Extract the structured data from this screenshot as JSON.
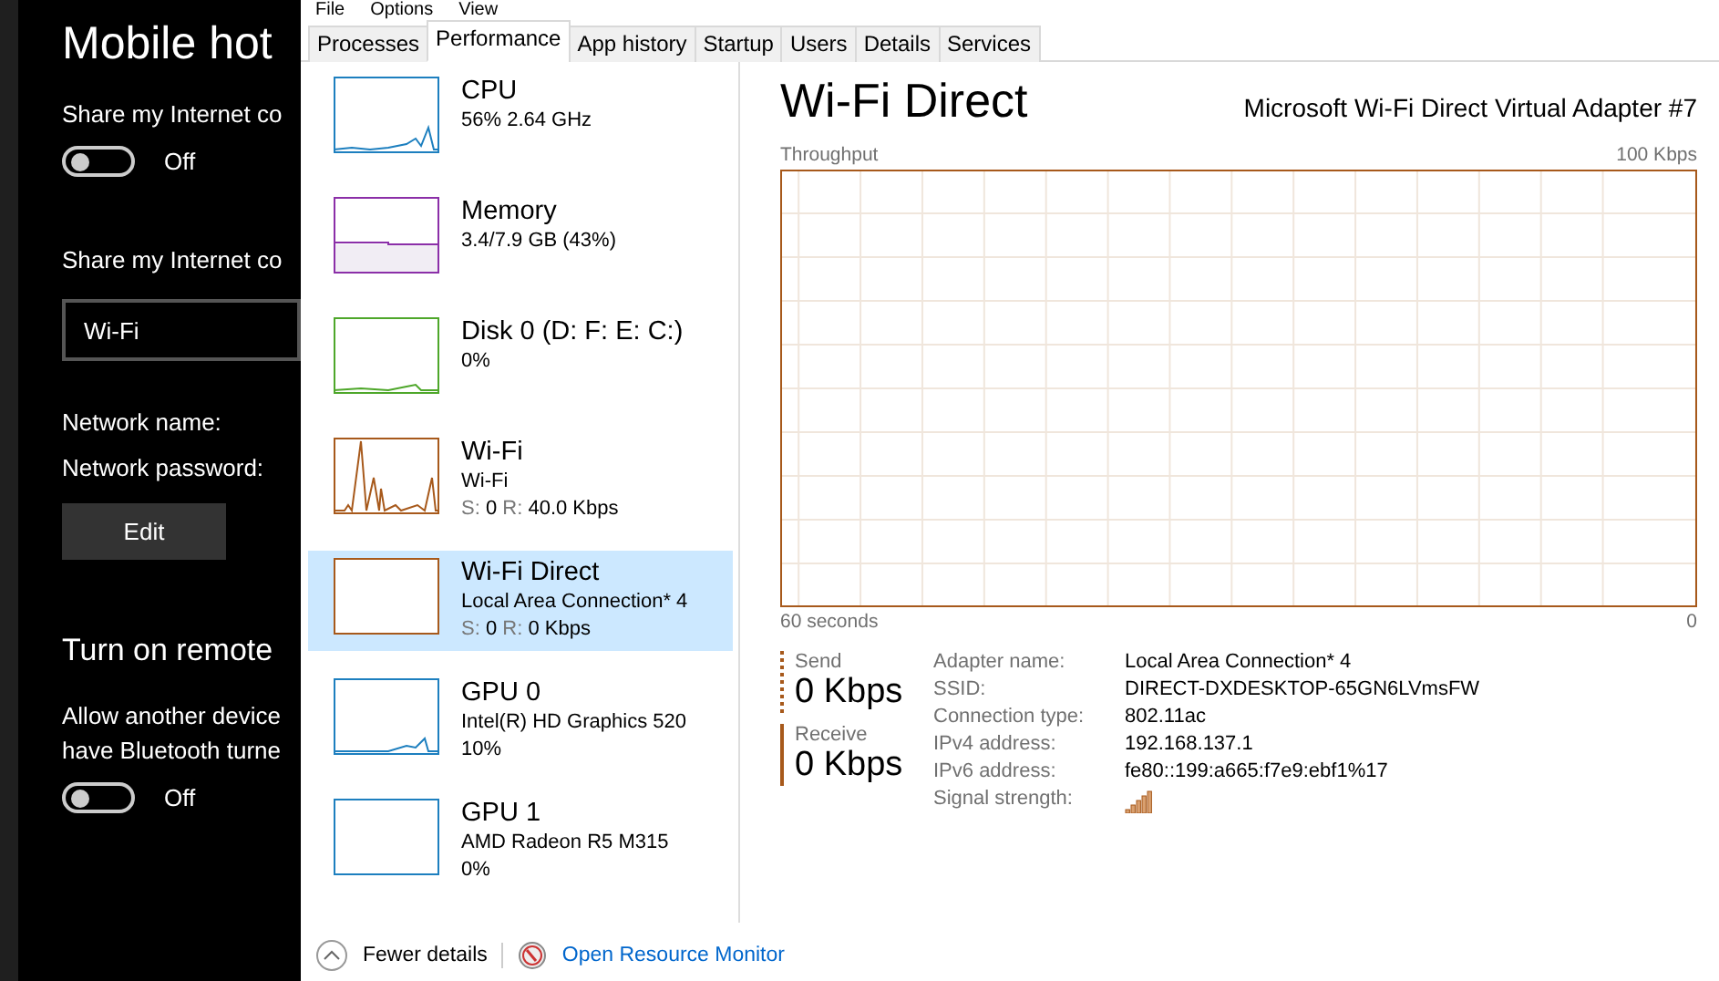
{
  "settings": {
    "title": "Mobile hot",
    "share_label": "Share my Internet co",
    "share_toggle": {
      "on": false,
      "label": "Off"
    },
    "share_from_label": "Share my Internet co",
    "share_from": {
      "value": "Wi-Fi"
    },
    "network_name_label": "Network name:",
    "network_password_label": "Network password:",
    "edit_button": "Edit",
    "remote_title": "Turn on remote",
    "remote_text": "Allow another device",
    "remote_text_2": "have Bluetooth turne",
    "remote_toggle": {
      "on": false,
      "label": "Off"
    }
  },
  "menu": [
    "File",
    "Options",
    "View"
  ],
  "tabs": [
    {
      "label": "Processes",
      "selected": false
    },
    {
      "label": "Performance",
      "selected": true
    },
    {
      "label": "App history",
      "selected": false
    },
    {
      "label": "Startup",
      "selected": false
    },
    {
      "label": "Users",
      "selected": false
    },
    {
      "label": "Details",
      "selected": false
    },
    {
      "label": "Services",
      "selected": false
    }
  ],
  "sidebar": {
    "items": [
      {
        "name": "CPU",
        "line_1": "56% 2.64 GHz",
        "color": "#1d7fbf",
        "selected": false
      },
      {
        "name": "Memory",
        "line_1": "3.4/7.9 GB (43%)",
        "color": "#8b2fa8",
        "selected": false
      },
      {
        "name": "Disk 0 (D: F: E: C:)",
        "line_1": "0%",
        "color": "#4ea72a",
        "selected": false
      },
      {
        "name": "Wi-Fi",
        "line_1": "Wi-Fi",
        "send_label": "S:",
        "send": "0",
        "receive_label": "R:",
        "receive": "40.0 Kbps",
        "color": "#a7591b",
        "selected": false
      },
      {
        "name": "Wi-Fi Direct",
        "line_1": "Local Area Connection* 4",
        "send_label": "S:",
        "send": "0",
        "receive_label": "R:",
        "receive": "0 Kbps",
        "color": "#a7591b",
        "selected": true
      },
      {
        "name": "GPU 0",
        "line_1": "Intel(R) HD Graphics 520",
        "line_2": "10%",
        "color": "#1d7fbf",
        "selected": false
      },
      {
        "name": "GPU 1",
        "line_1": "AMD Radeon R5 M315",
        "line_2": "0%",
        "color": "#1d7fbf",
        "selected": false
      }
    ]
  },
  "detail": {
    "title": "Wi-Fi Direct",
    "adapter": "Microsoft Wi-Fi Direct Virtual Adapter #7",
    "graph_label": "Throughput",
    "graph_max": "100 Kbps",
    "graph_time": "60 seconds",
    "graph_min": "0",
    "send": {
      "label": "Send",
      "value": "0 Kbps"
    },
    "receive": {
      "label": "Receive",
      "value": "0 Kbps"
    },
    "properties": [
      {
        "label": "Adapter name:",
        "value": "Local Area Connection* 4"
      },
      {
        "label": "SSID:",
        "value": "DIRECT-DXDESKTOP-65GN6LVmsFW"
      },
      {
        "label": "Connection type:",
        "value": "802.11ac"
      },
      {
        "label": "IPv4 address:",
        "value": "192.168.137.1"
      },
      {
        "label": "IPv6 address:",
        "value": "fe80::199:a665:f7e9:ebf1%17"
      },
      {
        "label": "Signal strength:",
        "kind": "signal"
      }
    ]
  },
  "footer": {
    "fewer_details": "Fewer details",
    "resource_monitor": "Open Resource Monitor"
  }
}
